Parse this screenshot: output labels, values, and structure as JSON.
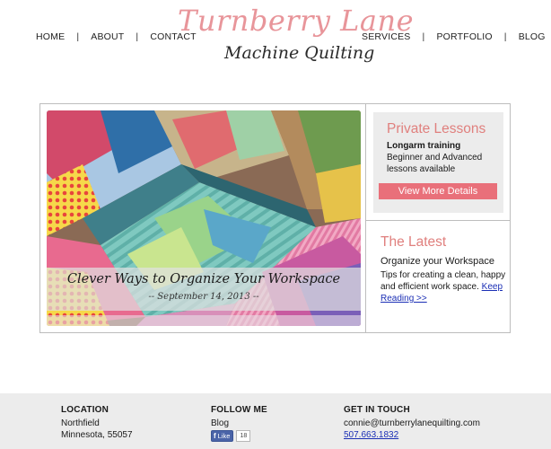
{
  "nav": {
    "left": [
      "HOME",
      "ABOUT",
      "CONTACT"
    ],
    "right": [
      "SERVICES",
      "PORTFOLIO",
      "BLOG"
    ],
    "separator": "|"
  },
  "logo": {
    "line1": "Turnberry Lane",
    "line2": "Machine Quilting"
  },
  "hero": {
    "title": "Clever Ways to Organize Your Workspace",
    "date": "-- September 14, 2013 --"
  },
  "lessons": {
    "title": "Private Lessons",
    "strong": "Longarm training",
    "desc": "Beginner and Advanced lessons available",
    "button": "View More Details"
  },
  "latest": {
    "title": "The Latest",
    "heading": "Organize your Workspace",
    "desc": "Tips for creating a clean, happy and efficient work space.",
    "link": "Keep Reading >>"
  },
  "footer": {
    "location": {
      "heading": "LOCATION",
      "line1": "Northfield",
      "line2": "Minnesota, 55057"
    },
    "follow": {
      "heading": "FOLLOW ME",
      "blog": "Blog",
      "like_label": "Like",
      "like_count": "18"
    },
    "contact": {
      "heading": "GET IN TOUCH",
      "email": "connie@turnberrylanequilting.com",
      "phone": "507.663.1832"
    }
  },
  "colors": {
    "accent_pink": "#e0807e",
    "button_pink": "#e9707a",
    "link_blue": "#1b2fb5",
    "footer_bg": "#ececec",
    "panel_bg": "#ececec"
  },
  "icons": {
    "facebook": "facebook-like-icon"
  }
}
